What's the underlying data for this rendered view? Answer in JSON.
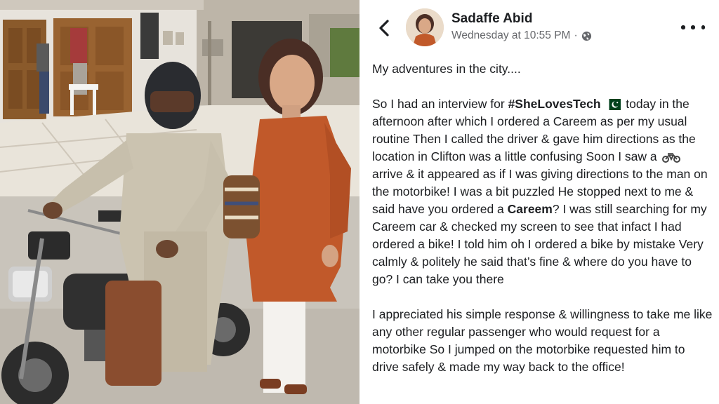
{
  "post": {
    "author": "Sadaffe Abid",
    "timestamp": "Wednesday at 10:55 PM",
    "separator": "·",
    "privacy_icon": "globe-icon",
    "back_icon": "chevron-left-icon",
    "more_icon": "more-horizontal-icon",
    "intro": "My adventures in the city....",
    "p1_a": "So I had an interview for ",
    "hashtag": "#SheLovesTech",
    "flag_emoji": "pakistan-flag-icon",
    "p1_b": " today in the afternoon after which I ordered a Careem as per my usual routine Then I called the driver & gave him directions as the location in Clifton was a little confusing Soon I saw a ",
    "bike_emoji": "motorcycle-icon",
    "p1_c": " arrive & it appeared as if I was giving directions to the man on the motorbike! I was a bit puzzled He stopped next to me & said have you ordered a ",
    "careem_bold": "Careem",
    "p1_d": "? I was still searching for my Careem car & checked my screen to see that infact I had ordered a bike! I told him oh I ordered a bike by mistake Very calmly & politely he said that’s fine & where do you have to go? I can take you there",
    "p2": "I appreciated his simple response & willingness to take me like any other regular passenger who would request for a motorbike So I jumped on the motorbike requested him to drive safely & made my way back to the office!"
  },
  "colors": {
    "text": "#1c1e21",
    "secondary": "#65676b",
    "flag_green": "#01411c",
    "shirt_orange": "#c1592a"
  }
}
